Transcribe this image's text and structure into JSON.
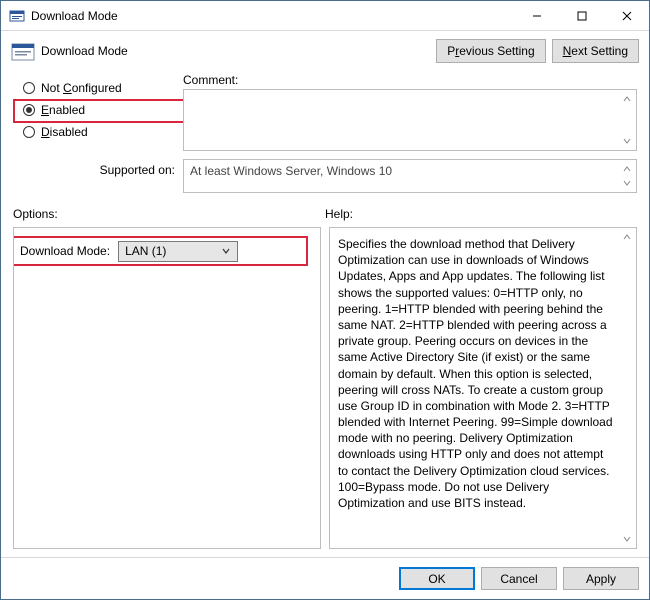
{
  "window": {
    "title": "Download Mode"
  },
  "header": {
    "title": "Download Mode",
    "prev_pre": "P",
    "prev_ul": "r",
    "prev_post": "evious Setting",
    "next_ul": "N",
    "next_post": "ext Setting"
  },
  "radios": {
    "nc_pre": "Not ",
    "nc_ul": "C",
    "nc_post": "onfigured",
    "en_ul": "E",
    "en_post": "nabled",
    "di_ul": "D",
    "di_post": "isabled",
    "selected": "enabled"
  },
  "labels": {
    "comment": "Comment:",
    "supported_on": "Supported on:",
    "options": "Options:",
    "help": "Help:",
    "download_mode": "Download Mode:"
  },
  "supported_on_text": "At least Windows Server, Windows 10",
  "select": {
    "value": "LAN (1)"
  },
  "help_text": "Specifies the download method that Delivery Optimization can use in downloads of Windows Updates, Apps and App updates. The following list shows the supported values: 0=HTTP only, no peering. 1=HTTP blended with peering behind the same NAT. 2=HTTP blended with peering across a private group. Peering occurs on devices in the same Active Directory Site (if exist) or the same domain by default. When this option is selected, peering will cross NATs. To create a custom group use Group ID in combination with Mode 2. 3=HTTP blended with Internet Peering. 99=Simple download mode with no peering. Delivery Optimization downloads using HTTP only and does not attempt to contact the Delivery Optimization cloud services. 100=Bypass mode. Do not use Delivery Optimization and use BITS instead.",
  "footer": {
    "ok": "OK",
    "cancel": "Cancel",
    "apply": "Apply"
  }
}
